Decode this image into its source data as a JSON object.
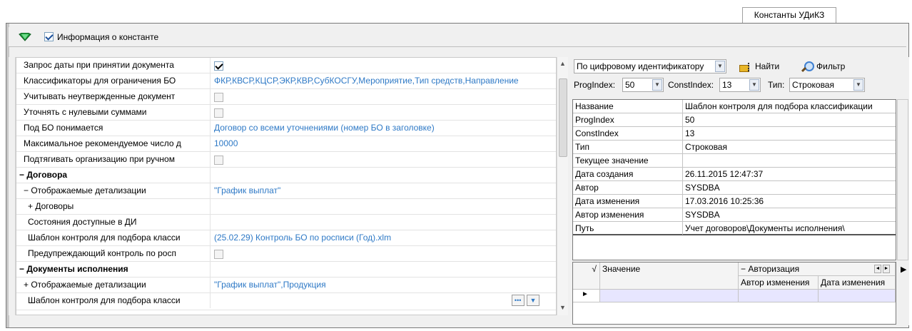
{
  "tab": {
    "label": "Константы УДиКЗ"
  },
  "topbar": {
    "info_label": "Информация о константе"
  },
  "props": [
    {
      "name": "Запрос даты при принятии документа",
      "value": "",
      "kind": "check-on"
    },
    {
      "name": "Классификаторы для ограничения БО",
      "value": "ФКР,КВСР,КЦСР,ЭКР,КВР,СубКОСГУ,Мероприятие,Тип средств,Направление",
      "kind": "text"
    },
    {
      "name": "Учитывать неутвержденные документ",
      "value": "",
      "kind": "check-off"
    },
    {
      "name": "Уточнять с нулевыми суммами",
      "value": "",
      "kind": "check-off"
    },
    {
      "name": "Под БО понимается",
      "value": "Договор со всеми уточнениями (номер БО в заголовке)",
      "kind": "text"
    },
    {
      "name": "Максимальное рекомендуемое число д",
      "value": "10000",
      "kind": "text"
    },
    {
      "name": "Подтягивать организацию при ручном",
      "value": "",
      "kind": "check-off"
    },
    {
      "name": "− Договора",
      "value": "",
      "kind": "group"
    },
    {
      "name": "− Отображаемые детализации",
      "value": "\"График выплат\"",
      "kind": "sub"
    },
    {
      "name": "+ Договоры",
      "value": "",
      "kind": "sub2"
    },
    {
      "name": "Состояния доступные в ДИ",
      "value": "",
      "kind": "sub"
    },
    {
      "name": "Шаблон контроля для подбора класси",
      "value": "(25.02.29) Контроль БО по росписи (Год).xlm",
      "kind": "sub"
    },
    {
      "name": "Предупреждающий контроль по росп",
      "value": "",
      "kind": "sub-check"
    },
    {
      "name": "− Документы исполнения",
      "value": "",
      "kind": "group"
    },
    {
      "name": "+ Отображаемые детализации",
      "value": "\"График выплат\",Продукция",
      "kind": "sub"
    },
    {
      "name": "Шаблон контроля для подбора класси",
      "value": "",
      "kind": "sub-last"
    }
  ],
  "search": {
    "mode": "По цифровому идентификатору",
    "find_label": "Найти",
    "filter_label": "Фильтр",
    "progindex_label": "ProgIndex:",
    "progindex_value": "50",
    "constindex_label": "ConstIndex:",
    "constindex_value": "13",
    "type_label": "Тип:",
    "type_value": "Строковая"
  },
  "info": [
    {
      "k": "Название",
      "v": "Шаблон контроля для подбора классификации"
    },
    {
      "k": "ProgIndex",
      "v": "50"
    },
    {
      "k": "ConstIndex",
      "v": "13"
    },
    {
      "k": "Тип",
      "v": "Строковая"
    },
    {
      "k": "Текущее значение",
      "v": ""
    },
    {
      "k": "Дата создания",
      "v": "26.11.2015 12:47:37"
    },
    {
      "k": "Автор",
      "v": "SYSDBA"
    },
    {
      "k": "Дата изменения",
      "v": "17.03.2016 10:25:36"
    },
    {
      "k": "Автор изменения",
      "v": "SYSDBA"
    },
    {
      "k": "Путь",
      "v": "Учет договоров\\Документы исполнения\\"
    }
  ],
  "values_table": {
    "col_value": "Значение",
    "group_auth": "− Авторизация",
    "col_author": "Автор изменения",
    "col_date": "Дата изменения"
  },
  "icons": {
    "gem": "green-gem-icon",
    "find": "find-icon",
    "filter": "magnifier-icon",
    "ellipsis": "ellipsis-icon"
  },
  "colors": {
    "value_link": "#2e79c6",
    "selected_row": "#e7e6ff"
  }
}
